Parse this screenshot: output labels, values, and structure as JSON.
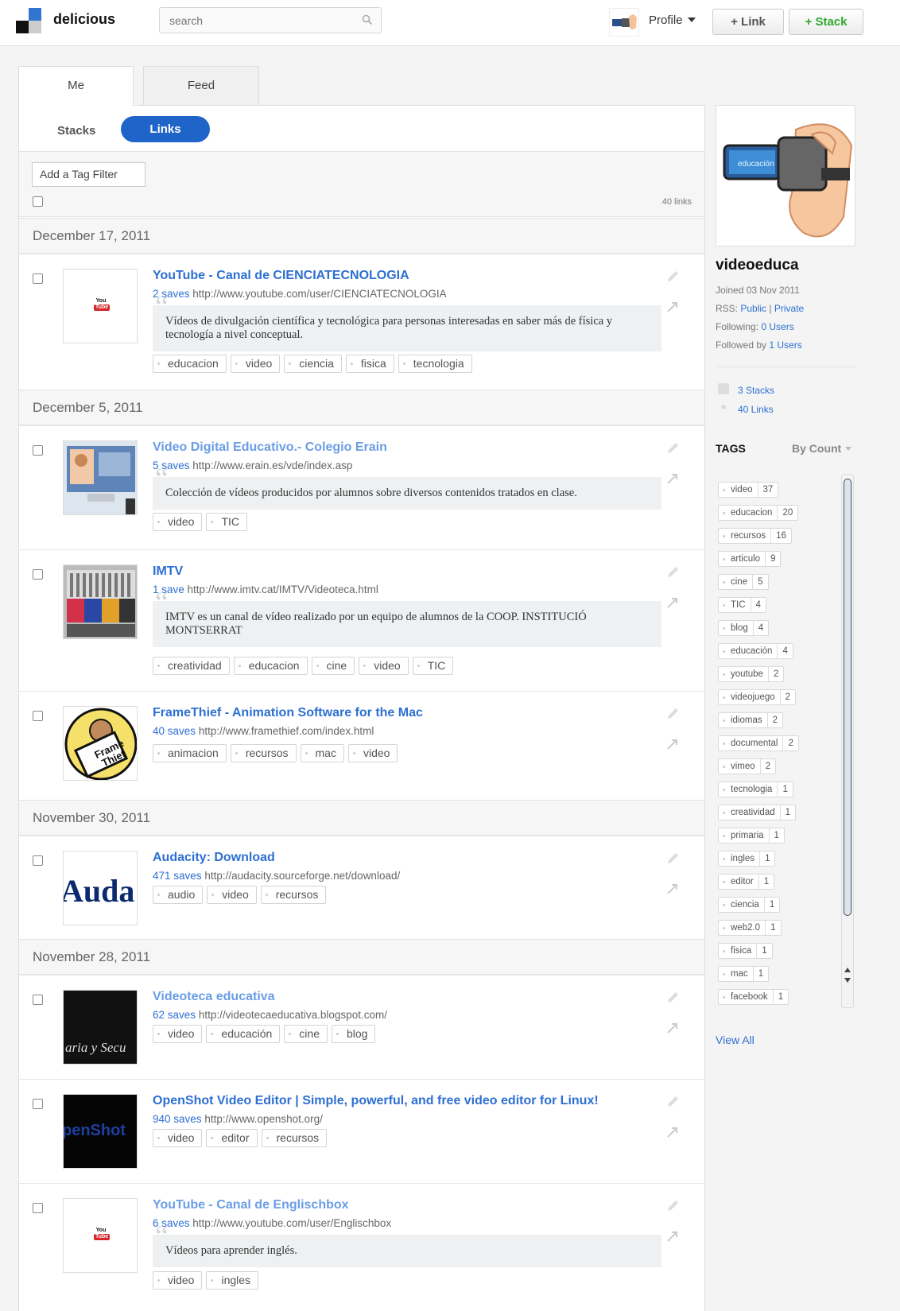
{
  "header": {
    "brand": "delicious",
    "search_placeholder": "search",
    "profile_label": "Profile",
    "add_link_label": "+ Link",
    "add_stack_label": "+ Stack"
  },
  "tabs": {
    "me": "Me",
    "feed": "Feed"
  },
  "subtabs": {
    "stacks": "Stacks",
    "links": "Links"
  },
  "filter": {
    "add_tag_filter": "Add a Tag Filter",
    "links_count": "40 links"
  },
  "dates": [
    "December 17, 2011",
    "December 5, 2011",
    "November 30, 2011",
    "November 28, 2011"
  ],
  "links": [
    {
      "title": "YouTube - Canal de CIENCIATECNOLOGIA",
      "saves": "2 saves",
      "url": "http://www.youtube.com/user/CIENCIATECNOLOGIA",
      "description": "Vídeos de divulgación científica y tecnológica para personas interesadas en saber más de física y tecnología a nivel conceptual.",
      "tags": [
        "educacion",
        "video",
        "ciencia",
        "fisica",
        "tecnologia"
      ],
      "thumb_text": "You Tube"
    },
    {
      "title": "Video Digital Educativo.- Colegio Erain",
      "saves": "5 saves",
      "url": "http://www.erain.es/vde/index.asp",
      "description": "Colección de vídeos producidos por alumnos sobre diversos contenidos tratados en clase.",
      "tags": [
        "video",
        "TIC"
      ]
    },
    {
      "title": "IMTV",
      "saves": "1 save",
      "url": "http://www.imtv.cat/IMTV/Videoteca.html",
      "description": "IMTV es un canal de vídeo realizado por un equipo de alumnos de la COOP. INSTITUCIÓ MONTSERRAT",
      "tags": [
        "creatividad",
        "educacion",
        "cine",
        "video",
        "TIC"
      ]
    },
    {
      "title": "FrameThief - Animation Software for the Mac",
      "saves": "40 saves",
      "url": "http://www.framethief.com/index.html",
      "tags": [
        "animacion",
        "recursos",
        "mac",
        "video"
      ],
      "thumb_text": "Frame Thief"
    },
    {
      "title": "Audacity: Download",
      "saves": "471 saves",
      "url": "http://audacity.sourceforge.net/download/",
      "tags": [
        "audio",
        "video",
        "recursos"
      ],
      "thumb_text": "Auda"
    },
    {
      "title": "Videoteca educativa",
      "saves": "62 saves",
      "url": "http://videotecaeducativa.blogspot.com/",
      "tags": [
        "video",
        "educación",
        "cine",
        "blog"
      ],
      "thumb_text": "aria y Secu"
    },
    {
      "title": "OpenShot Video Editor | Simple, powerful, and free video editor for Linux!",
      "saves": "940 saves",
      "url": "http://www.openshot.org/",
      "tags": [
        "video",
        "editor",
        "recursos"
      ],
      "thumb_text": "penShot"
    },
    {
      "title": "YouTube - Canal de Englischbox",
      "saves": "6 saves",
      "url": "http://www.youtube.com/user/Englischbox",
      "description": "Vídeos para aprender inglés.",
      "tags": [
        "video",
        "ingles"
      ],
      "thumb_text": "You Tube"
    }
  ],
  "sidebar": {
    "avatar_label": "educación",
    "username": "videoeduca",
    "joined": "Joined 03 Nov 2011",
    "rss_label": "RSS:",
    "rss_public": "Public",
    "rss_sep": "|",
    "rss_private": "Private",
    "following_label": "Following:",
    "following_users": "0 Users",
    "followed_label": "Followed by",
    "followed_users": "1 Users",
    "stacks": "3 Stacks",
    "links": "40 Links",
    "tags_heading": "TAGS",
    "sort_label": "By Count",
    "tags": [
      {
        "name": "video",
        "count": "37"
      },
      {
        "name": "educacion",
        "count": "20"
      },
      {
        "name": "recursos",
        "count": "16"
      },
      {
        "name": "articulo",
        "count": "9"
      },
      {
        "name": "cine",
        "count": "5"
      },
      {
        "name": "TIC",
        "count": "4"
      },
      {
        "name": "blog",
        "count": "4"
      },
      {
        "name": "educación",
        "count": "4"
      },
      {
        "name": "youtube",
        "count": "2"
      },
      {
        "name": "videojuego",
        "count": "2"
      },
      {
        "name": "idiomas",
        "count": "2"
      },
      {
        "name": "documental",
        "count": "2"
      },
      {
        "name": "vimeo",
        "count": "2"
      },
      {
        "name": "tecnologia",
        "count": "1"
      },
      {
        "name": "creatividad",
        "count": "1"
      },
      {
        "name": "primaria",
        "count": "1"
      },
      {
        "name": "ingles",
        "count": "1"
      },
      {
        "name": "editor",
        "count": "1"
      },
      {
        "name": "ciencia",
        "count": "1"
      },
      {
        "name": "web2.0",
        "count": "1"
      },
      {
        "name": "fisica",
        "count": "1"
      },
      {
        "name": "mac",
        "count": "1"
      },
      {
        "name": "facebook",
        "count": "1"
      }
    ],
    "view_all": "View All"
  },
  "colors": {
    "link_blue": "#2d6fd2",
    "visited_blue": "#6a9de6",
    "stack_green": "#2ea82e",
    "active_tab": "#1f64c9"
  }
}
